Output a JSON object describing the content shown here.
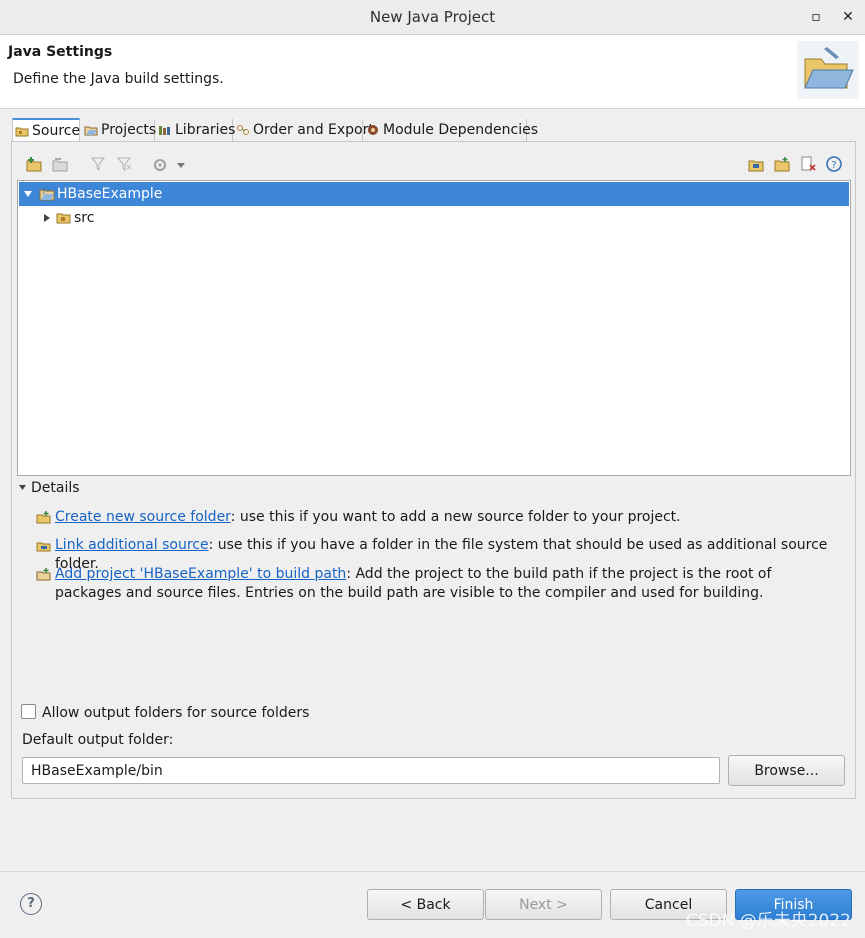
{
  "window": {
    "title": "New Java Project",
    "maximize_glyph": "▫",
    "close_glyph": "✕"
  },
  "banner": {
    "heading": "Java Settings",
    "description": "Define the Java build settings."
  },
  "tabs": [
    {
      "label": "Source",
      "icon": "source-folder-icon",
      "active": true
    },
    {
      "label": "Projects",
      "icon": "projects-icon",
      "active": false
    },
    {
      "label": "Libraries",
      "icon": "libraries-icon",
      "active": false
    },
    {
      "label": "Order and Export",
      "icon": "order-export-icon",
      "active": false
    },
    {
      "label": "Module Dependencies",
      "icon": "module-icon",
      "active": false
    }
  ],
  "tree": {
    "project": "HBaseExample",
    "child": "src"
  },
  "details": {
    "header": "Details",
    "items": [
      {
        "link": "Create new source folder",
        "text": ": use this if you want to add a new source folder to your project."
      },
      {
        "link": "Link additional source",
        "text": ": use this if you have a folder in the file system that should be used as additional source folder."
      },
      {
        "link": "Add project 'HBaseExample' to build path",
        "text": ": Add the project to the build path if the project is the root of packages and source files. Entries on the build path are visible to the compiler and used for building."
      }
    ]
  },
  "options": {
    "allow_output_label": "Allow output folders for source folders",
    "default_output_label": "Default output folder:",
    "default_output_value": "HBaseExample/bin",
    "browse_label": "Browse..."
  },
  "footer": {
    "help_glyph": "?",
    "back_label": "< Back",
    "next_label": "Next >",
    "cancel_label": "Cancel",
    "finish_label": "Finish",
    "watermark": "CSDN @乐未央2022"
  },
  "colors": {
    "selection": "#3d86d8",
    "link": "#1763c4",
    "primary": "#2d7fd3"
  }
}
